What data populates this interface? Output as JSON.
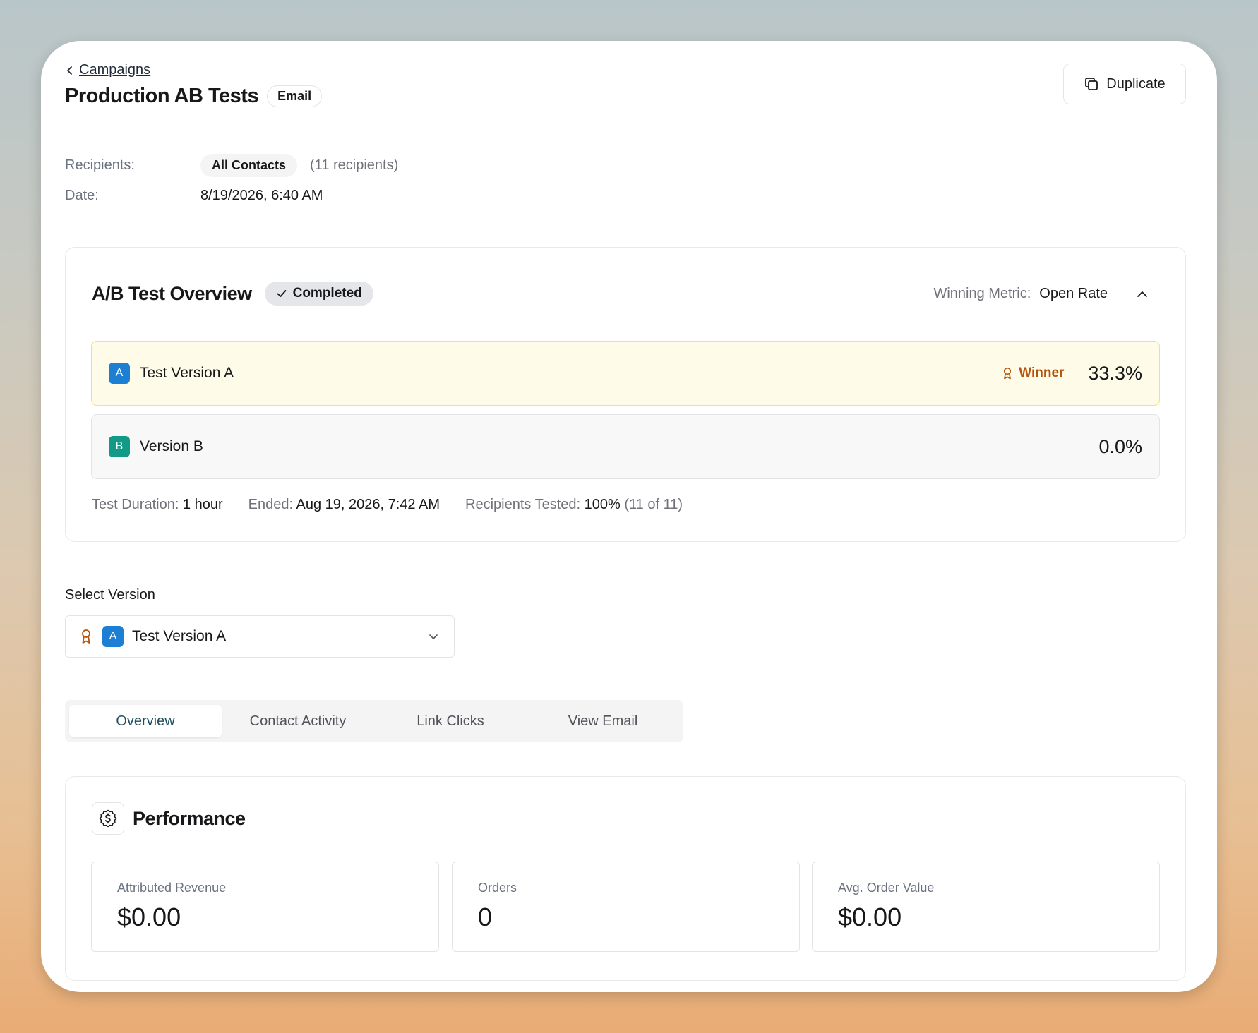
{
  "header": {
    "back_label": "Campaigns",
    "title": "Production AB Tests",
    "channel_badge": "Email",
    "duplicate_label": "Duplicate"
  },
  "meta": {
    "recipients_label": "Recipients:",
    "recipients_value": "All Contacts",
    "recipients_count": "(11 recipients)",
    "date_label": "Date:",
    "date_value": "8/19/2026, 6:40 AM"
  },
  "ab_test": {
    "title": "A/B Test Overview",
    "status": "Completed",
    "winning_metric_label": "Winning Metric:",
    "winning_metric_value": "Open Rate",
    "versions": [
      {
        "badge": "A",
        "name": "Test Version A",
        "winner_label": "Winner",
        "rate": "33.3%",
        "badge_color": "#1d7fd4"
      },
      {
        "badge": "B",
        "name": "Version B",
        "rate": "0.0%",
        "badge_color": "#139a87"
      }
    ],
    "footer": {
      "duration_label": "Test Duration:",
      "duration_value": "1 hour",
      "ended_label": "Ended:",
      "ended_value": "Aug 19, 2026, 7:42 AM",
      "tested_label": "Recipients Tested:",
      "tested_value": "100%",
      "tested_detail": "(11 of 11)"
    }
  },
  "version_select": {
    "label": "Select Version",
    "selected_badge": "A",
    "selected_value": "Test Version A"
  },
  "tabs": [
    {
      "label": "Overview",
      "active": true
    },
    {
      "label": "Contact Activity",
      "active": false
    },
    {
      "label": "Link Clicks",
      "active": false
    },
    {
      "label": "View Email",
      "active": false
    }
  ],
  "performance": {
    "title": "Performance",
    "stats": [
      {
        "label": "Attributed Revenue",
        "value": "$0.00"
      },
      {
        "label": "Orders",
        "value": "0"
      },
      {
        "label": "Avg. Order Value",
        "value": "$0.00"
      }
    ]
  },
  "colors": {
    "winner": "#b45309",
    "winner_bg": "#fefbe8",
    "active_tab_text": "#1e4f5c"
  }
}
